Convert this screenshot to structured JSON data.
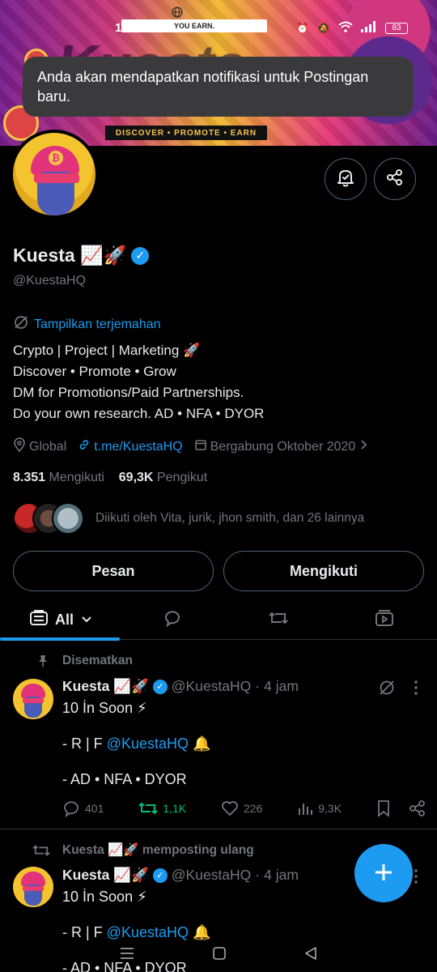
{
  "status_bar": {
    "time": "19.43",
    "battery": "83"
  },
  "banner": {
    "top_text": "YOU EARN.",
    "big_word": "Kuesta",
    "ribbon_text": "DISCOVER • PROMOTE • EARN"
  },
  "toast": {
    "text": "Anda akan mendapatkan notifikasi untuk Postingan baru."
  },
  "profile": {
    "name": "Kuesta 📈🚀",
    "handle": "@KuestaHQ",
    "translate_label": "Tampilkan terjemahan",
    "bio": [
      "Crypto | Project | Marketing 🚀",
      "Discover • Promote • Grow",
      "DM for Promotions/Paid Partnerships.",
      "Do your own research. AD • NFA • DYOR"
    ],
    "location": "Global",
    "link": "t.me/KuestaHQ",
    "joined": "Bergabung Oktober 2020",
    "following_count": "8.351",
    "following_label": "Mengikuti",
    "followers_count": "69,3K",
    "followers_label": "Pengikut",
    "followed_by": "Diikuti oleh Vita, jurik, jhon smith, dan 26 lainnya"
  },
  "buttons": {
    "message": "Pesan",
    "following": "Mengikuti"
  },
  "tabs": {
    "all_label": "All"
  },
  "posts": [
    {
      "label": "Disematkan",
      "author": "Kuesta 📈🚀",
      "handle": "@KuestaHQ",
      "time": "4 jam",
      "line1": "10 İn Soon ⚡",
      "line2_prefix": "- R | F ",
      "line2_mention": "@KuestaHQ",
      "line2_suffix": " 🔔",
      "line3": "- AD • NFA • DYOR",
      "replies": "401",
      "reposts": "1,1K",
      "likes": "226",
      "views": "9,3K"
    },
    {
      "label": "Kuesta 📈🚀 memposting ulang",
      "author": "Kuesta 📈🚀",
      "handle": "@KuestaHQ",
      "time": "4 jam",
      "line1": "10 İn Soon ⚡",
      "line2_prefix": "- R | F ",
      "line2_mention": "@KuestaHQ",
      "line2_suffix": " 🔔",
      "line3": "- AD • NFA • DYOR"
    }
  ],
  "colors": {
    "accent": "#1d9bf0",
    "repost_green": "#00ba7c",
    "muted": "#71767b"
  },
  "icons": [
    "globe-icon",
    "x-logo-icon",
    "alarm-icon",
    "mute-icon",
    "wifi-icon",
    "signal-icon",
    "notification-bell-icon",
    "share-icon",
    "translate-icon",
    "location-icon",
    "link-icon",
    "calendar-icon",
    "chevron-right-icon",
    "list-icon",
    "chevron-down-icon",
    "reply-icon",
    "repost-icon",
    "video-icon",
    "pin-icon",
    "more-icon",
    "like-icon",
    "views-icon",
    "bookmark-icon",
    "plus-icon"
  ]
}
